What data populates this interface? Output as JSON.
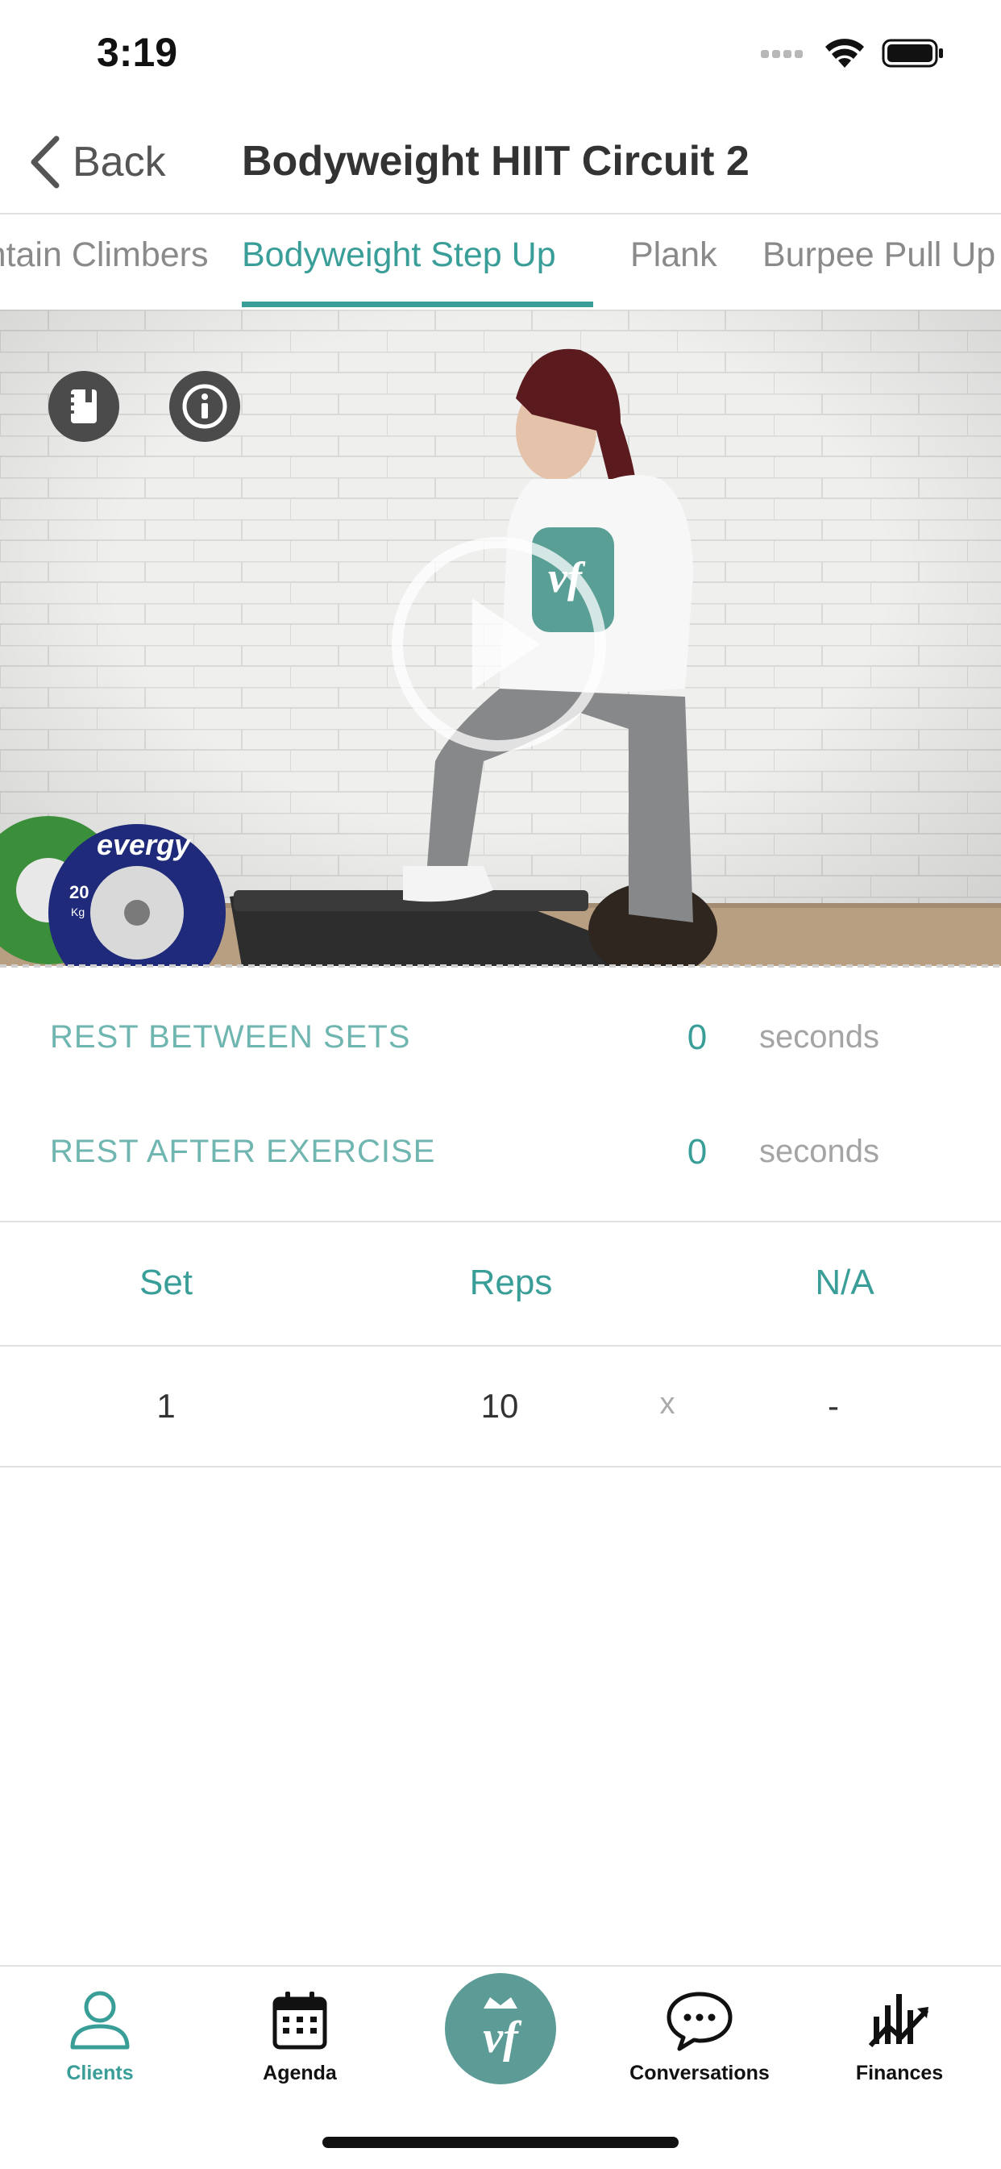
{
  "status_bar": {
    "time": "3:19"
  },
  "nav": {
    "back_label": "Back",
    "title": "Bodyweight HIIT Circuit 2"
  },
  "exercise_tabs": [
    {
      "label": "Mountain Climbers",
      "active": false
    },
    {
      "label": "Bodyweight Step Up",
      "active": true
    },
    {
      "label": "Plank",
      "active": false
    },
    {
      "label": "Burpee Pull Up",
      "active": false
    }
  ],
  "video": {
    "notes_icon": "notebook-icon",
    "info_icon": "info-icon",
    "play_icon": "play-icon",
    "plate_text_left": "evergy",
    "plate_text_right": "evergy",
    "plate_weight": "20",
    "plate_unit": "Kg",
    "shirt_logo": "vf"
  },
  "rest": {
    "between_sets": {
      "label": "REST BETWEEN SETS",
      "value": "0",
      "unit": "seconds"
    },
    "after_exercise": {
      "label": "REST AFTER EXERCISE",
      "value": "0",
      "unit": "seconds"
    }
  },
  "table": {
    "headers": [
      "Set",
      "Reps",
      "N/A"
    ],
    "rows": [
      {
        "set": "1",
        "reps": "10",
        "separator": "x",
        "na": "-"
      }
    ]
  },
  "tab_bar": {
    "items": [
      {
        "label": "Clients",
        "icon": "person-icon",
        "active": true
      },
      {
        "label": "Agenda",
        "icon": "calendar-icon",
        "active": false
      },
      {
        "label": "Conversations",
        "icon": "chat-bubble-icon",
        "active": false
      },
      {
        "label": "Finances",
        "icon": "chart-icon",
        "active": false
      }
    ],
    "center_logo": "vf"
  },
  "colors": {
    "accent": "#3a9e98",
    "accent_light": "#6fb5b0",
    "logo_bg": "#5c9b96"
  }
}
